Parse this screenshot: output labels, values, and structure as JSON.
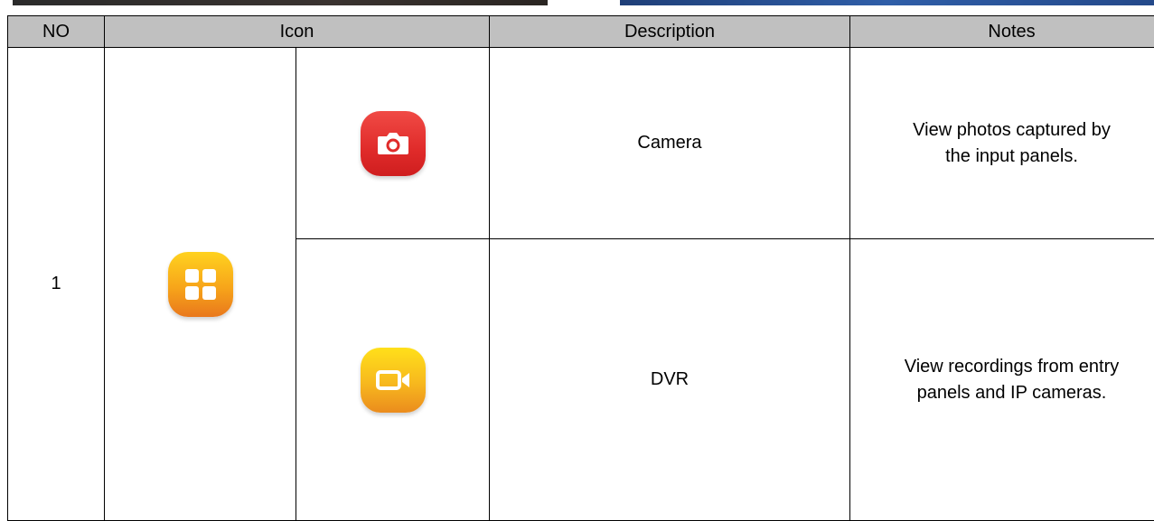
{
  "table": {
    "headers": {
      "no": "NO",
      "icon": "Icon",
      "description": "Description",
      "notes": "Notes"
    },
    "group": {
      "no": "1",
      "group_icon": "apps-grid-icon",
      "items": [
        {
          "icon": "camera-icon",
          "description": "Camera",
          "notes_line1": "View photos captured by",
          "notes_line2": "the input panels."
        },
        {
          "icon": "video-camera-icon",
          "description": "DVR",
          "notes_line1": "View recordings from entry",
          "notes_line2": "panels and IP cameras."
        }
      ]
    }
  },
  "colors": {
    "header_bg": "#c0c0c0",
    "apps_icon": "#f7a51a",
    "camera_icon": "#e02b2a",
    "dvr_icon": "#f7b81e"
  }
}
